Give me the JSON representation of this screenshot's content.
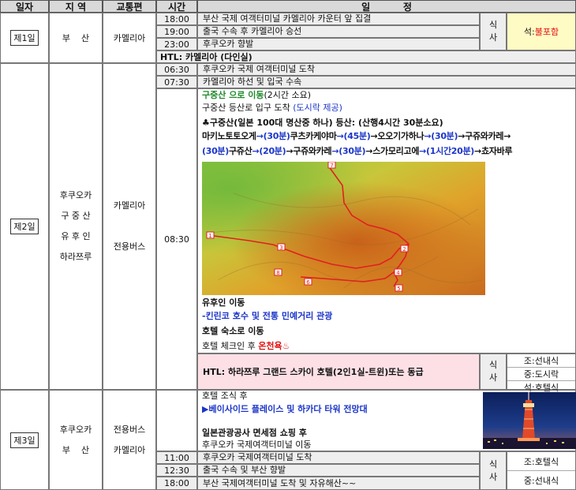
{
  "header": {
    "day": "일자",
    "region": "지 역",
    "transport": "교통편",
    "time": "시간",
    "schedule": "일          정"
  },
  "meal_label": {
    "line1": "식",
    "line2": "사"
  },
  "day1": {
    "label": "제1일",
    "region": "부    산",
    "transport": "카멜리아",
    "rows": [
      {
        "time": "18:00",
        "text": "부산 국제 여객터미널 카멜리아 카운터 앞 집결"
      },
      {
        "time": "19:00",
        "text": "출국 수속 후 카멜리아 승선"
      },
      {
        "time": "23:00",
        "text": "후쿠오카 향발"
      }
    ],
    "meal_prefix": "석:",
    "meal_value": "불포함",
    "htl": "HTL: 카멜리아 (다인실)"
  },
  "day2": {
    "label": "제2일",
    "regions": [
      "후쿠오카",
      "구 중 산",
      "유 후 인",
      "하라쯔루"
    ],
    "transports": [
      "카멜리아",
      "전용버스"
    ],
    "rows": [
      {
        "time": "06:30",
        "text": "후쿠오카 국제 여객터미널 도착"
      },
      {
        "time": "07:30",
        "text": "카멜리아 하선 및 입국 수속"
      }
    ],
    "time_main": "08:30",
    "move_title": "구중산 으로 이동",
    "move_note": "(2시간 소요)",
    "trailhead": "구중산 등산로 입구 도착 ",
    "lunch_note": "(도시락 제공)",
    "hike_title": "♣구중산(일본 100대 명산중 하나) 등산: (산행4시간 30분소요)",
    "route_line1": [
      {
        "t": "마키노토토오게",
        "c": "k"
      },
      {
        "t": "→(30분)",
        "c": "b"
      },
      {
        "t": "쿠츠카케야마",
        "c": "k"
      },
      {
        "t": "→(45분)",
        "c": "b"
      },
      {
        "t": "→오오기가하나",
        "c": "k"
      },
      {
        "t": "→(30분)",
        "c": "b"
      },
      {
        "t": "→구쥬와카레→",
        "c": "k"
      }
    ],
    "route_line2": [
      {
        "t": "(30분)",
        "c": "b"
      },
      {
        "t": "구쥬산",
        "c": "k"
      },
      {
        "t": "→(20분)",
        "c": "b"
      },
      {
        "t": "→구쥬와카레",
        "c": "k"
      },
      {
        "t": "→(30분)",
        "c": "b"
      },
      {
        "t": "→스가모리고에",
        "c": "k"
      },
      {
        "t": "→(1시간20분)",
        "c": "b"
      },
      {
        "t": "→쵸자바루",
        "c": "k"
      }
    ],
    "map_markers": [
      "1",
      "2",
      "3",
      "4",
      "5",
      "6",
      "7",
      "8"
    ],
    "yufuin_move": "유후인 이동",
    "kinrinko": "-킨린코 호수 및 전통 민예거리 관광",
    "hotel_move": "호텔 숙소로 이동",
    "checkin": "호텔 체크인 후 ",
    "onsen": "온천욕",
    "htl": "HTL: 하라쯔루 그랜드 스카이 호텔(2인1실-트윈)또는 동급",
    "meals": [
      "조:선내식",
      "중:도시락",
      "석:호텔식"
    ]
  },
  "day3": {
    "label": "제3일",
    "regions": [
      "후쿠오카",
      "부    산"
    ],
    "transports": [
      "전용버스",
      "카멜리아"
    ],
    "breakfast_line": "호텔 조식 후",
    "tour_line": "▶베이사이드 플레이스 및 하카다 타워 전망대",
    "shopping_line": "일본관광공사 면세점 쇼핑 후",
    "terminal_move": "후쿠오카 국제여객터미널 이동",
    "rows": [
      {
        "time": "11:00",
        "text": "후쿠오카 국제여객터미널 도착"
      },
      {
        "time": "12:30",
        "text": "출국 수속 및 부산 향발"
      },
      {
        "time": "18:00",
        "text": "부산 국제여객터미널 도착 및 자유해산~~"
      }
    ],
    "meals": [
      "조:호텔식",
      "중:선내식"
    ]
  }
}
